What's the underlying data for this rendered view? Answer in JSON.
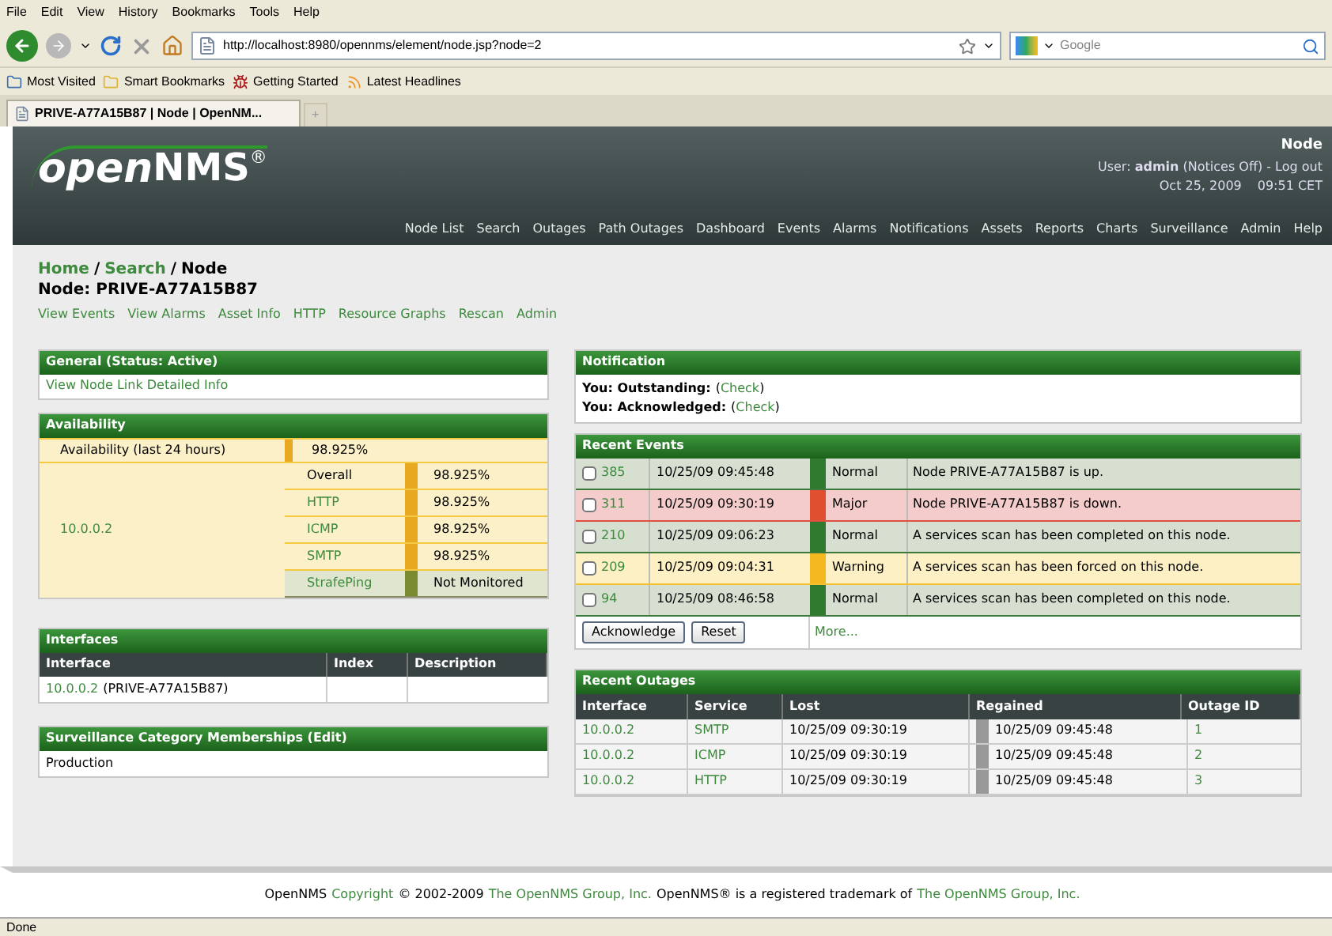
{
  "browser": {
    "menu": [
      "File",
      "Edit",
      "View",
      "History",
      "Bookmarks",
      "Tools",
      "Help"
    ],
    "url": "http://localhost:8980/opennms/element/node.jsp?node=2",
    "search_placeholder": "Google",
    "bookmarks": [
      "Most Visited",
      "Smart Bookmarks",
      "Getting Started",
      "Latest Headlines"
    ],
    "tab_title": "PRIVE-A77A15B87 | Node | OpenNM...",
    "new_tab": "+",
    "status": "Done"
  },
  "header": {
    "logo_open": "open",
    "logo_nms": "NMS",
    "logo_mark": "®",
    "page_title": "Node",
    "user_line": "User: **admin** (Notices Off) - Log out",
    "date": "Oct 25, 2009",
    "time": "09:51 CET",
    "nav": [
      "Node List",
      "Search",
      "Outages",
      "Path Outages",
      "Dashboard",
      "Events",
      "Alarms",
      "Notifications",
      "Assets",
      "Reports",
      "Charts",
      "Surveillance",
      "Admin",
      "Help"
    ]
  },
  "breadcrumbs": {
    "items": [
      {
        "label": "Home",
        "link": true
      },
      {
        "label": "Search",
        "link": true
      },
      {
        "label": "Node",
        "link": false
      }
    ],
    "separator": "/"
  },
  "node_title": "Node: PRIVE-A77A15B87",
  "actions": [
    "View Events",
    "View Alarms",
    "Asset Info",
    "HTTP",
    "Resource Graphs",
    "Rescan",
    "Admin"
  ],
  "general": {
    "title": "General (Status: Active)",
    "link": "View Node Link Detailed Info"
  },
  "availability": {
    "title": "Availability",
    "label": "Availability (last 24 hours)",
    "value": "98.925%",
    "interface": "10.0.0.2",
    "services": [
      {
        "name": "Overall",
        "value": "98.925%",
        "kind": "overall"
      },
      {
        "name": "HTTP",
        "value": "98.925%",
        "kind": "service"
      },
      {
        "name": "ICMP",
        "value": "98.925%",
        "kind": "service"
      },
      {
        "name": "SMTP",
        "value": "98.925%",
        "kind": "service"
      },
      {
        "name": "StrafePing",
        "value": "Not Monitored",
        "kind": "unmonitored"
      }
    ]
  },
  "interfaces": {
    "title": "Interfaces",
    "columns": [
      "Interface",
      "Index",
      "Description"
    ],
    "rows": [
      {
        "interface": "10.0.0.2",
        "host": "(PRIVE-A77A15B87)"
      }
    ]
  },
  "surveillance": {
    "title": "Surveillance Category Memberships (Edit)",
    "items": [
      "Production"
    ]
  },
  "notification": {
    "title": "Notification",
    "lines": [
      {
        "label": "You: Outstanding:",
        "open": "(",
        "link": "Check",
        "close": ")"
      },
      {
        "label": "You: Acknowledged:",
        "open": "(",
        "link": "Check",
        "close": ")"
      }
    ]
  },
  "events": {
    "title": "Recent Events",
    "rows": [
      {
        "checked": false,
        "id": "385",
        "time": "10/25/09 09:45:48",
        "severity": "Normal",
        "kind": "normal",
        "message": "Node PRIVE-A77A15B87 is up."
      },
      {
        "checked": false,
        "id": "311",
        "time": "10/25/09 09:30:19",
        "severity": "Major",
        "kind": "major",
        "message": "Node PRIVE-A77A15B87 is down."
      },
      {
        "checked": false,
        "id": "210",
        "time": "10/25/09 09:06:23",
        "severity": "Normal",
        "kind": "normal",
        "message": "A services scan has been completed on this node."
      },
      {
        "checked": false,
        "id": "209",
        "time": "10/25/09 09:04:31",
        "severity": "Warning",
        "kind": "warning",
        "message": "A services scan has been forced on this node."
      },
      {
        "checked": false,
        "id": "94",
        "time": "10/25/09 08:46:58",
        "severity": "Normal",
        "kind": "normal",
        "message": "A services scan has been completed on this node."
      }
    ],
    "buttons": [
      "Acknowledge",
      "Reset"
    ],
    "more": "More..."
  },
  "outages": {
    "title": "Recent Outages",
    "columns": [
      "Interface",
      "Service",
      "Lost",
      "Regained",
      "Outage ID"
    ],
    "rows": [
      {
        "interface": "10.0.0.2",
        "service": "SMTP",
        "lost": "10/25/09 09:30:19",
        "regained": "10/25/09 09:45:48",
        "id": "1"
      },
      {
        "interface": "10.0.0.2",
        "service": "ICMP",
        "lost": "10/25/09 09:30:19",
        "regained": "10/25/09 09:45:48",
        "id": "2"
      },
      {
        "interface": "10.0.0.2",
        "service": "HTTP",
        "lost": "10/25/09 09:30:19",
        "regained": "10/25/09 09:45:48",
        "id": "3"
      }
    ]
  },
  "footer": [
    {
      "text": "OpenNMS",
      "link": false
    },
    {
      "text": "Copyright",
      "link": true
    },
    {
      "text": "© 2002-2009",
      "link": false
    },
    {
      "text": "The OpenNMS Group, Inc.",
      "link": true
    },
    {
      "text": "OpenNMS® is a registered trademark of",
      "link": false
    },
    {
      "text": "The OpenNMS Group, Inc.",
      "link": true
    }
  ]
}
